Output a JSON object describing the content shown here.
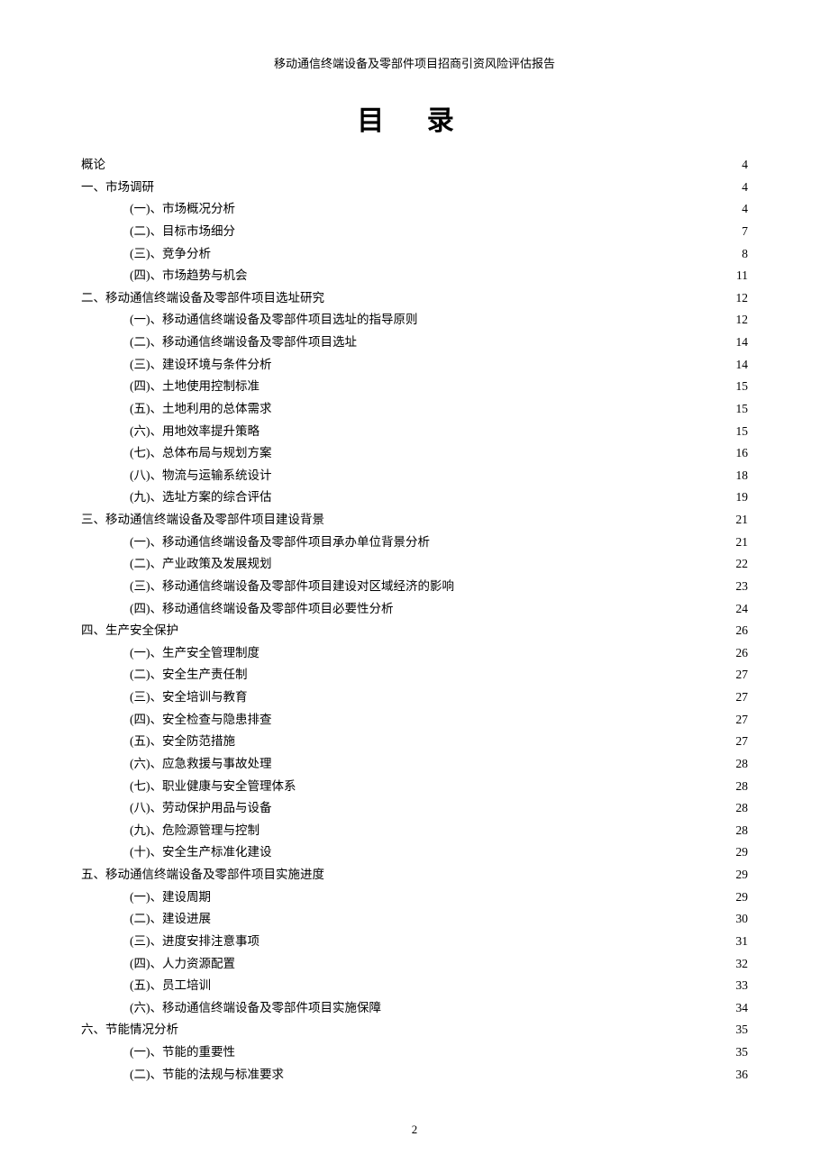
{
  "header": "移动通信终端设备及零部件项目招商引资风险评估报告",
  "title": "目 录",
  "page_number": "2",
  "toc": [
    {
      "level": 0,
      "label": "概论",
      "page": "4"
    },
    {
      "level": 1,
      "label": "一、市场调研",
      "page": "4"
    },
    {
      "level": 2,
      "label": "(一)、市场概况分析",
      "page": "4"
    },
    {
      "level": 2,
      "label": "(二)、目标市场细分",
      "page": "7"
    },
    {
      "level": 2,
      "label": "(三)、竞争分析",
      "page": "8"
    },
    {
      "level": 2,
      "label": "(四)、市场趋势与机会",
      "page": "11"
    },
    {
      "level": 1,
      "label": "二、移动通信终端设备及零部件项目选址研究",
      "page": "12"
    },
    {
      "level": 2,
      "label": "(一)、移动通信终端设备及零部件项目选址的指导原则",
      "page": "12"
    },
    {
      "level": 2,
      "label": "(二)、移动通信终端设备及零部件项目选址",
      "page": "14"
    },
    {
      "level": 2,
      "label": "(三)、建设环境与条件分析",
      "page": "14"
    },
    {
      "level": 2,
      "label": "(四)、土地使用控制标准",
      "page": "15"
    },
    {
      "level": 2,
      "label": "(五)、土地利用的总体需求",
      "page": "15"
    },
    {
      "level": 2,
      "label": "(六)、用地效率提升策略",
      "page": "15"
    },
    {
      "level": 2,
      "label": "(七)、总体布局与规划方案",
      "page": "16"
    },
    {
      "level": 2,
      "label": "(八)、物流与运输系统设计",
      "page": "18"
    },
    {
      "level": 2,
      "label": "(九)、选址方案的综合评估",
      "page": "19"
    },
    {
      "level": 1,
      "label": "三、移动通信终端设备及零部件项目建设背景",
      "page": "21"
    },
    {
      "level": 2,
      "label": "(一)、移动通信终端设备及零部件项目承办单位背景分析",
      "page": "21"
    },
    {
      "level": 2,
      "label": "(二)、产业政策及发展规划",
      "page": "22"
    },
    {
      "level": 2,
      "label": "(三)、移动通信终端设备及零部件项目建设对区域经济的影响",
      "page": "23"
    },
    {
      "level": 2,
      "label": "(四)、移动通信终端设备及零部件项目必要性分析",
      "page": "24"
    },
    {
      "level": 1,
      "label": "四、生产安全保护",
      "page": "26"
    },
    {
      "level": 2,
      "label": "(一)、生产安全管理制度",
      "page": "26"
    },
    {
      "level": 2,
      "label": "(二)、安全生产责任制",
      "page": "27"
    },
    {
      "level": 2,
      "label": "(三)、安全培训与教育",
      "page": "27"
    },
    {
      "level": 2,
      "label": "(四)、安全检查与隐患排查",
      "page": "27"
    },
    {
      "level": 2,
      "label": "(五)、安全防范措施",
      "page": "27"
    },
    {
      "level": 2,
      "label": "(六)、应急救援与事故处理",
      "page": "28"
    },
    {
      "level": 2,
      "label": "(七)、职业健康与安全管理体系",
      "page": "28"
    },
    {
      "level": 2,
      "label": "(八)、劳动保护用品与设备",
      "page": "28"
    },
    {
      "level": 2,
      "label": "(九)、危险源管理与控制",
      "page": "28"
    },
    {
      "level": 2,
      "label": "(十)、安全生产标准化建设",
      "page": "29"
    },
    {
      "level": 1,
      "label": "五、移动通信终端设备及零部件项目实施进度",
      "page": "29"
    },
    {
      "level": 2,
      "label": "(一)、建设周期",
      "page": "29"
    },
    {
      "level": 2,
      "label": "(二)、建设进展",
      "page": "30"
    },
    {
      "level": 2,
      "label": "(三)、进度安排注意事项",
      "page": "31"
    },
    {
      "level": 2,
      "label": "(四)、人力资源配置",
      "page": "32"
    },
    {
      "level": 2,
      "label": "(五)、员工培训",
      "page": "33"
    },
    {
      "level": 2,
      "label": "(六)、移动通信终端设备及零部件项目实施保障",
      "page": "34"
    },
    {
      "level": 1,
      "label": "六、节能情况分析",
      "page": "35"
    },
    {
      "level": 2,
      "label": "(一)、节能的重要性",
      "page": "35"
    },
    {
      "level": 2,
      "label": "(二)、节能的法规与标准要求",
      "page": "36"
    }
  ]
}
